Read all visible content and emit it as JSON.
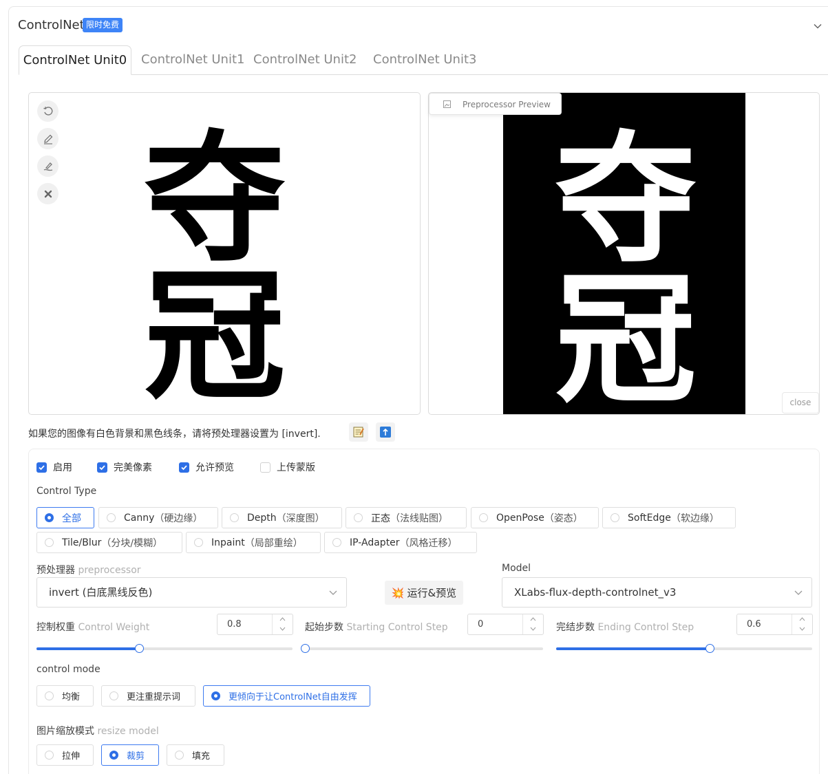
{
  "header": {
    "title": "ControlNet",
    "badge": "限时免费"
  },
  "tabs": [
    "ControlNet Unit0",
    "ControlNet Unit1",
    "ControlNet Unit2",
    "ControlNet Unit3"
  ],
  "active_tab": 0,
  "canvas": {
    "characters": [
      "夺",
      "冠"
    ]
  },
  "preview": {
    "label": "Preprocessor Preview",
    "close": "close"
  },
  "hint": {
    "text": "如果您的图像有白色背景和黑色线条，请将预处理器设置为 [invert]."
  },
  "checkboxes": [
    {
      "label": "启用",
      "checked": true
    },
    {
      "label": "完美像素",
      "checked": true
    },
    {
      "label": "允许预览",
      "checked": true
    },
    {
      "label": "上传蒙版",
      "checked": false
    }
  ],
  "control_type": {
    "label": "Control Type",
    "options": [
      {
        "name": "全部",
        "paren": "",
        "selected": true
      },
      {
        "name": "Canny",
        "paren": "（硬边缘）",
        "selected": false
      },
      {
        "name": "Depth",
        "paren": "（深度图）",
        "selected": false
      },
      {
        "name": "正态",
        "paren": "（法线贴图）",
        "selected": false
      },
      {
        "name": "OpenPose",
        "paren": "（姿态）",
        "selected": false
      },
      {
        "name": "SoftEdge",
        "paren": "（软边缘）",
        "selected": false
      },
      {
        "name": "Tile/Blur",
        "paren": "（分块/模糊）",
        "selected": false
      },
      {
        "name": "Inpaint",
        "paren": "（局部重绘）",
        "selected": false
      },
      {
        "name": "IP-Adapter",
        "paren": "（风格迁移）",
        "selected": false
      }
    ]
  },
  "preprocessor": {
    "label": "预处理器",
    "sub": "preprocessor",
    "value": "invert (白底黑线反色)"
  },
  "run_button": {
    "icon": "💥",
    "label": "运行&预览"
  },
  "model": {
    "label": "Model",
    "value": "XLabs-flux-depth-controlnet_v3"
  },
  "sliders": [
    {
      "label": "控制权重",
      "sub": "Control Weight",
      "value": "0.8",
      "min": 0,
      "max": 2,
      "fraction": 0.4
    },
    {
      "label": "起始步数",
      "sub": "Starting Control Step",
      "value": "0",
      "min": 0,
      "max": 1,
      "fraction": 0.0
    },
    {
      "label": "完结步数",
      "sub": "Ending Control Step",
      "value": "0.6",
      "min": 0,
      "max": 1,
      "fraction": 0.6
    }
  ],
  "control_mode": {
    "label": "control mode",
    "options": [
      {
        "name": "均衡",
        "selected": false
      },
      {
        "name": "更注重提示词",
        "selected": false
      },
      {
        "name": "更倾向于让ControlNet自由发挥",
        "selected": true
      }
    ]
  },
  "resize": {
    "label": "图片缩放模式",
    "sub": "resize model",
    "options": [
      {
        "name": "拉伸",
        "selected": false
      },
      {
        "name": "裁剪",
        "selected": true
      },
      {
        "name": "填充",
        "selected": false
      }
    ]
  },
  "colors": {
    "accent": "#2e6fe6",
    "badge": "#3e84f7"
  }
}
